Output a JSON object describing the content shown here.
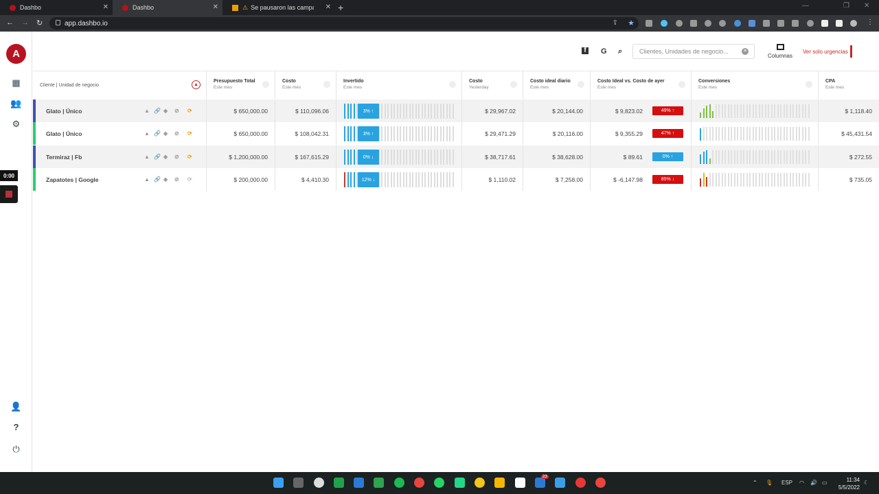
{
  "browser": {
    "tabs": [
      {
        "title": "Dashbo"
      },
      {
        "title": "Dashbo"
      },
      {
        "title": "Se pausaron las campañas"
      }
    ],
    "url": "app.dashbo.io"
  },
  "app": {
    "logo_letter": "A",
    "timer": "0:00"
  },
  "topbar": {
    "search_placeholder": "Clientes, Unidades de negocio...",
    "columns_label": "Columnas",
    "urgent_label": "Ver solo urgencias"
  },
  "table": {
    "headers": [
      {
        "title": "Cliente | Unidad de negocio",
        "sub": ""
      },
      {
        "title": "Presupuesto Total",
        "sub": "Este mes"
      },
      {
        "title": "Costo",
        "sub": "Este mes"
      },
      {
        "title": "Invertido",
        "sub": "Este mes"
      },
      {
        "title": "Costo",
        "sub": "Yesterday"
      },
      {
        "title": "Costo ideal diario",
        "sub": "Este mes"
      },
      {
        "title": "Costo Ideal vs. Costo de ayer",
        "sub": "Este mes"
      },
      {
        "title": "Conversiones",
        "sub": "Este mes"
      },
      {
        "title": "CPA",
        "sub": "Este mes"
      }
    ],
    "rows": [
      {
        "client": "Glato | Único",
        "accent": "#3f51b5",
        "budget": "$ 650,000.00",
        "cost": "$ 110,096.06",
        "invested_pct": "3% ↑",
        "invested_color": "#29a3e0",
        "cost_yesterday": "$ 29,967.02",
        "ideal_daily": "$ 20,144.00",
        "ideal_vs": "$ 9,823.02",
        "vs_pct": "49% ↑",
        "vs_color": "#d50f0f",
        "cpa": "$ 1,118.40"
      },
      {
        "client": "Glato | Único",
        "accent": "#2ecc71",
        "budget": "$ 650,000.00",
        "cost": "$ 108,042.31",
        "invested_pct": "3% ↑",
        "invested_color": "#29a3e0",
        "cost_yesterday": "$ 29,471.29",
        "ideal_daily": "$ 20,116.00",
        "ideal_vs": "$ 9,355.29",
        "vs_pct": "47% ↑",
        "vs_color": "#d50f0f",
        "cpa": "$ 45,431.54"
      },
      {
        "client": "Termiraz | Fb",
        "accent": "#3f51b5",
        "budget": "$ 1,200,000.00",
        "cost": "$ 167,615.29",
        "invested_pct": "0% ↓",
        "invested_color": "#29a3e0",
        "cost_yesterday": "$ 38,717.61",
        "ideal_daily": "$ 38,628.00",
        "ideal_vs": "$ 89.61",
        "vs_pct": "0% ↑",
        "vs_color": "#29a3e0",
        "cpa": "$ 272.55"
      },
      {
        "client": "Zapatotes | Google",
        "accent": "#2ecc71",
        "budget": "$ 200,000.00",
        "cost": "$ 4,410.30",
        "invested_pct": "12% ↓",
        "invested_color": "#29a3e0",
        "cost_yesterday": "$ 1,110.02",
        "ideal_daily": "$ 7,258.00",
        "ideal_vs": "$ -6,147.98",
        "vs_pct": "85% ↓",
        "vs_color": "#d50f0f",
        "cpa": "$ 735.05"
      }
    ]
  },
  "taskbar": {
    "lang": "ESP",
    "time": "11:34",
    "date": "5/5/2022",
    "badge": "23"
  }
}
